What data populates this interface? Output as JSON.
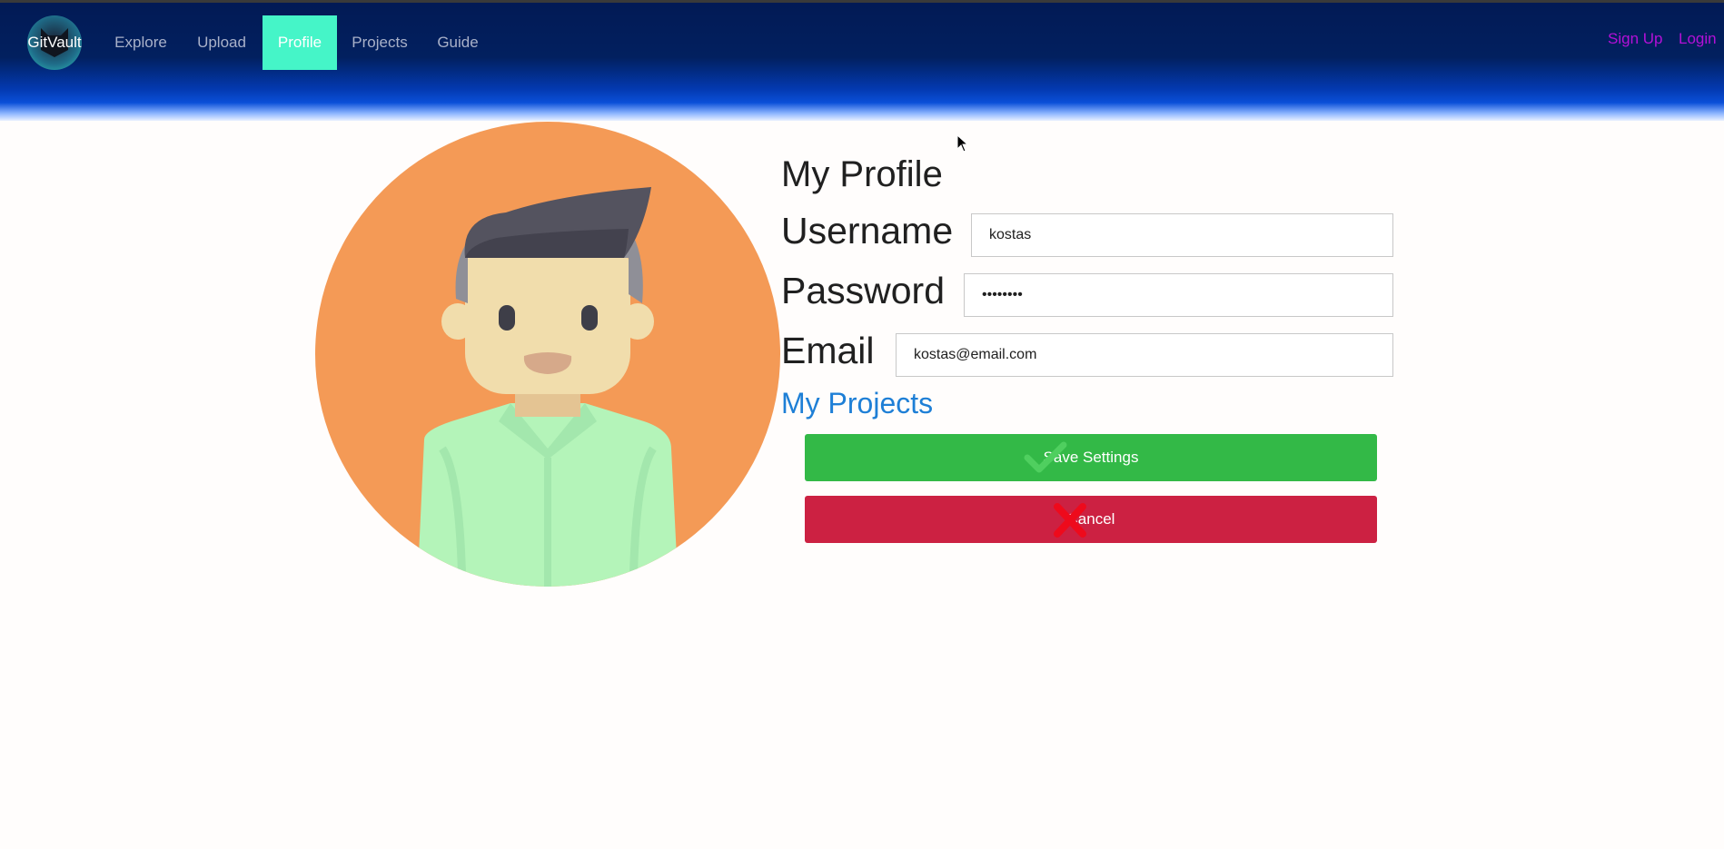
{
  "nav": {
    "logo_text": "GitVault",
    "links": [
      {
        "label": "Explore"
      },
      {
        "label": "Upload"
      },
      {
        "label": "Profile",
        "active": true
      },
      {
        "label": "Projects"
      },
      {
        "label": "Guide"
      }
    ],
    "sign_up": "Sign Up",
    "login": "Login"
  },
  "profile": {
    "title": "My Profile",
    "username_label": "Username",
    "username_value": "kostas",
    "password_label": "Password",
    "password_value": "kostas12",
    "email_label": "Email",
    "email_value": "kostas@email.com",
    "my_projects_link": "My Projects",
    "save_label": "Save Settings",
    "cancel_label": "Cancel"
  },
  "colors": {
    "active_tab": "#45f5c8",
    "auth_links": "#b510d8",
    "save_button": "#33b947",
    "cancel_button": "#cc2142",
    "projects_link": "#1e7fd6",
    "avatar_background": "#f49a56"
  }
}
